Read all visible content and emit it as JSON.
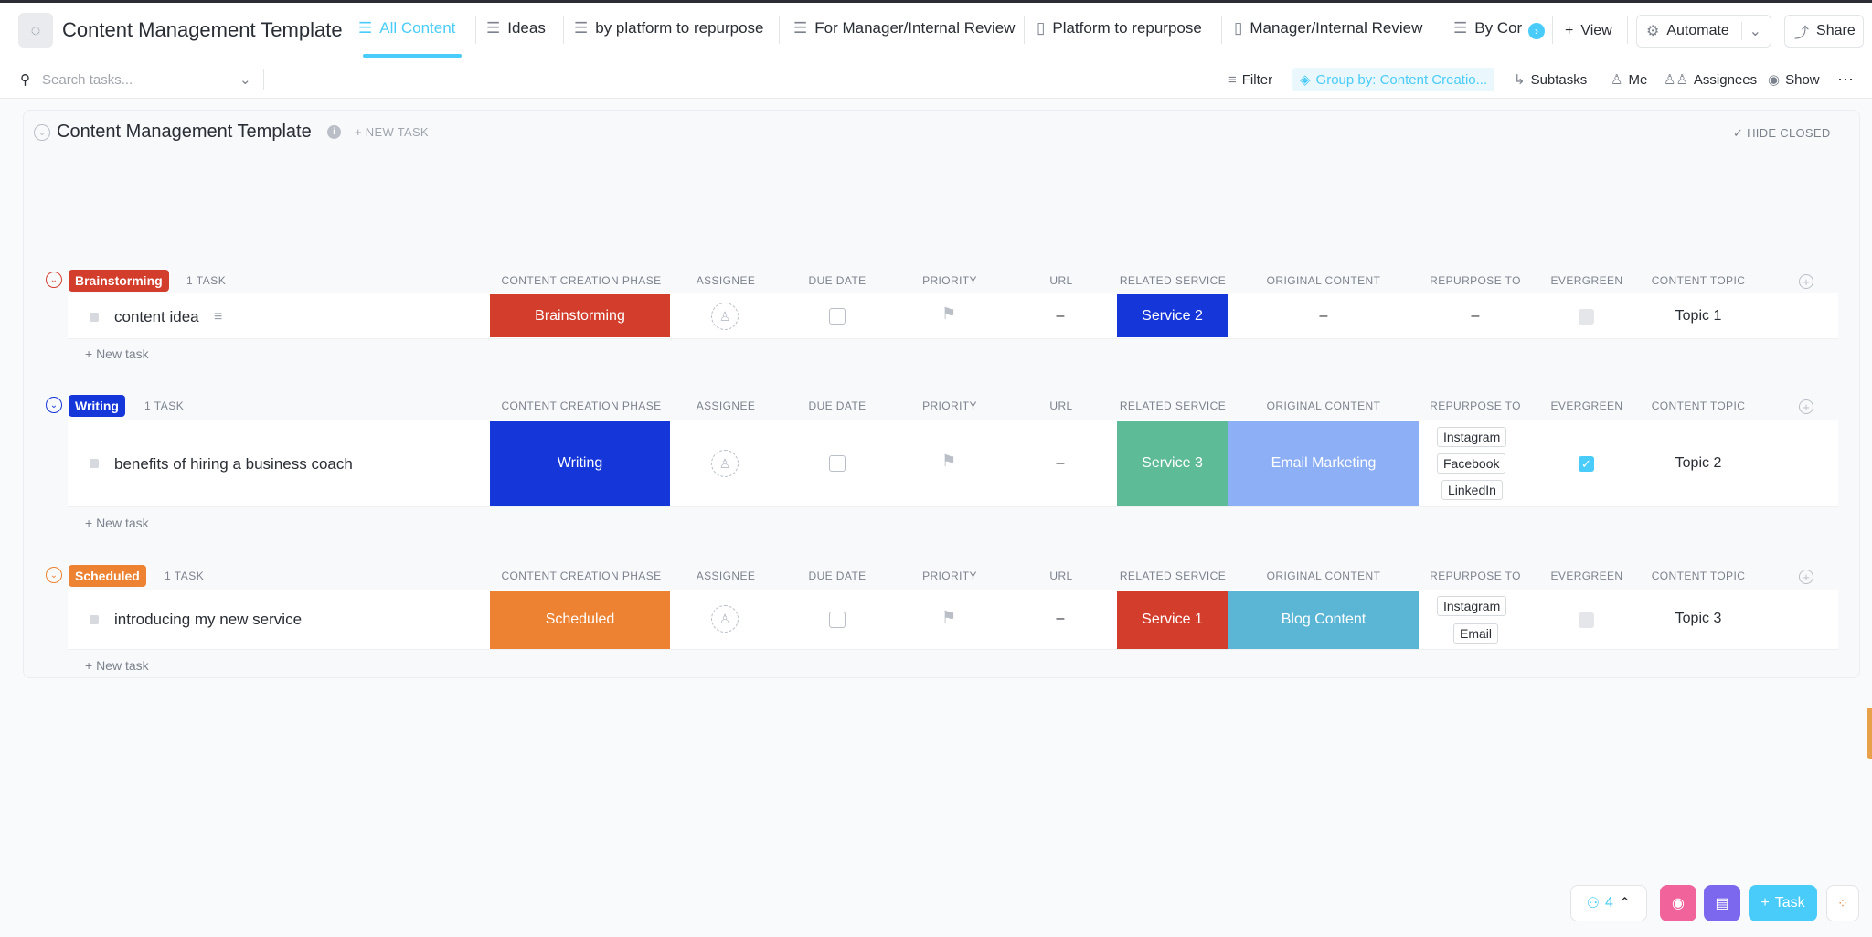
{
  "app": {
    "title": "Content Management Template"
  },
  "tabs": [
    {
      "label": "All Content",
      "active": true
    },
    {
      "label": "Ideas"
    },
    {
      "label": "by platform to repurpose"
    },
    {
      "label": "For Manager/Internal Review"
    },
    {
      "label": "Platform to repurpose"
    },
    {
      "label": "Manager/Internal Review"
    },
    {
      "label": "By Cor"
    }
  ],
  "header_actions": {
    "view": "View",
    "automate": "Automate",
    "share": "Share"
  },
  "toolbar": {
    "search_placeholder": "Search tasks...",
    "filter": "Filter",
    "group_by": "Group by: Content Creatio...",
    "subtasks": "Subtasks",
    "me": "Me",
    "assignees": "Assignees",
    "show": "Show"
  },
  "list": {
    "title": "Content Management Template",
    "new_task": "+ NEW TASK",
    "hide_closed": "HIDE CLOSED"
  },
  "columns": [
    "CONTENT CREATION PHASE",
    "ASSIGNEE",
    "DUE DATE",
    "PRIORITY",
    "URL",
    "RELATED SERVICE",
    "ORIGINAL CONTENT",
    "REPURPOSE TO",
    "EVERGREEN",
    "CONTENT TOPIC"
  ],
  "groups": [
    {
      "name": "Brainstorming",
      "color": "#d33d2c",
      "count": "1 TASK",
      "task": {
        "name": "content idea",
        "phase": "Brainstorming",
        "phase_color": "#d33d2c",
        "url": "–",
        "service": "Service 2",
        "service_color": "#1536d8",
        "original": "–",
        "original_color": "",
        "repurpose": [],
        "repurpose_empty": "–",
        "evergreen": false,
        "topic": "Topic 1"
      },
      "new_task": "+ New task"
    },
    {
      "name": "Writing",
      "color": "#1536d8",
      "count": "1 TASK",
      "task": {
        "name": "benefits of hiring a business coach",
        "phase": "Writing",
        "phase_color": "#1536d8",
        "url": "–",
        "service": "Service 3",
        "service_color": "#5dbb97",
        "original": "Email Marketing",
        "original_color": "#8caff5",
        "repurpose": [
          "Instagram",
          "Facebook",
          "LinkedIn"
        ],
        "evergreen": true,
        "topic": "Topic 2"
      },
      "new_task": "+ New task"
    },
    {
      "name": "Scheduled",
      "color": "#ec8232",
      "count": "1 TASK",
      "task": {
        "name": "introducing my new service",
        "phase": "Scheduled",
        "phase_color": "#ec8232",
        "url": "–",
        "service": "Service 1",
        "service_color": "#d33d2c",
        "original": "Blog Content",
        "original_color": "#5bb6d6",
        "repurpose": [
          "Instagram",
          "Email"
        ],
        "evergreen": false,
        "topic": "Topic 3"
      },
      "new_task": "+ New task"
    }
  ],
  "fabs": {
    "count": "4",
    "task": "Task"
  }
}
